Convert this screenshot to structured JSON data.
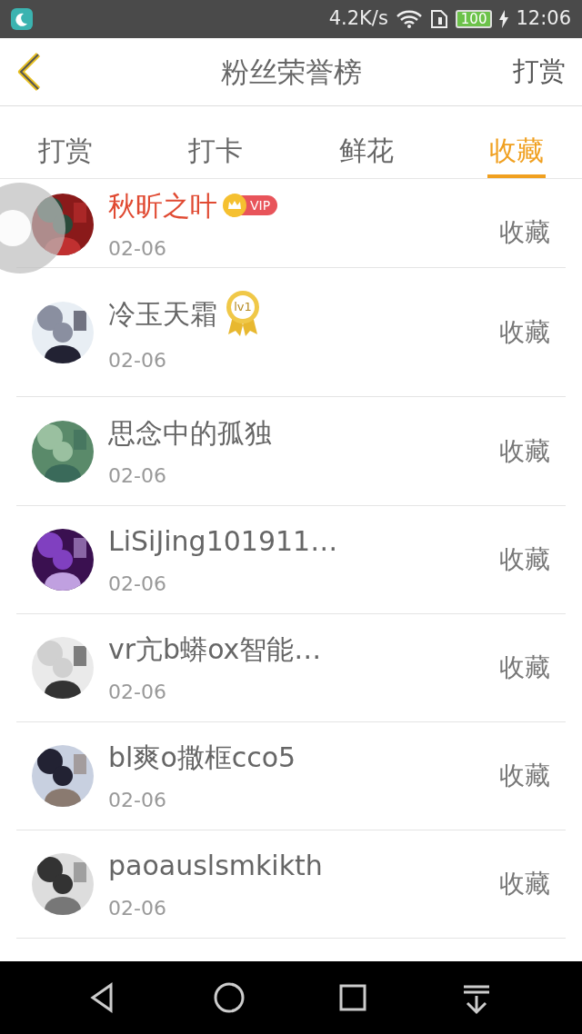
{
  "status_bar": {
    "speed": "4.2K/s",
    "battery": "100",
    "time": "12:06"
  },
  "header": {
    "title": "粉丝荣誉榜",
    "action": "打赏"
  },
  "tabs": [
    {
      "label": "打赏",
      "selected": false
    },
    {
      "label": "打卡",
      "selected": false
    },
    {
      "label": "鲜花",
      "selected": false
    },
    {
      "label": "收藏",
      "selected": true
    }
  ],
  "rows": [
    {
      "name": "秋昕之叶",
      "vip": true,
      "badge": {
        "kind": "vip",
        "text": "VIP"
      },
      "date": "02-06",
      "action": "收藏"
    },
    {
      "name": "冷玉天霜",
      "vip": false,
      "badge": {
        "kind": "level",
        "text": "lv1"
      },
      "date": "02-06",
      "action": "收藏"
    },
    {
      "name": "思念中的孤独",
      "vip": false,
      "date": "02-06",
      "action": "收藏"
    },
    {
      "name": "LiSiJing101911…",
      "vip": false,
      "date": "02-06",
      "action": "收藏"
    },
    {
      "name": "vr亢b蟒ox智能…",
      "vip": false,
      "date": "02-06",
      "action": "收藏"
    },
    {
      "name": "bl爽o撒框cco5",
      "vip": false,
      "date": "02-06",
      "action": "收藏"
    },
    {
      "name": "paoauslsmkikth",
      "vip": false,
      "date": "02-06",
      "action": "收藏"
    }
  ]
}
